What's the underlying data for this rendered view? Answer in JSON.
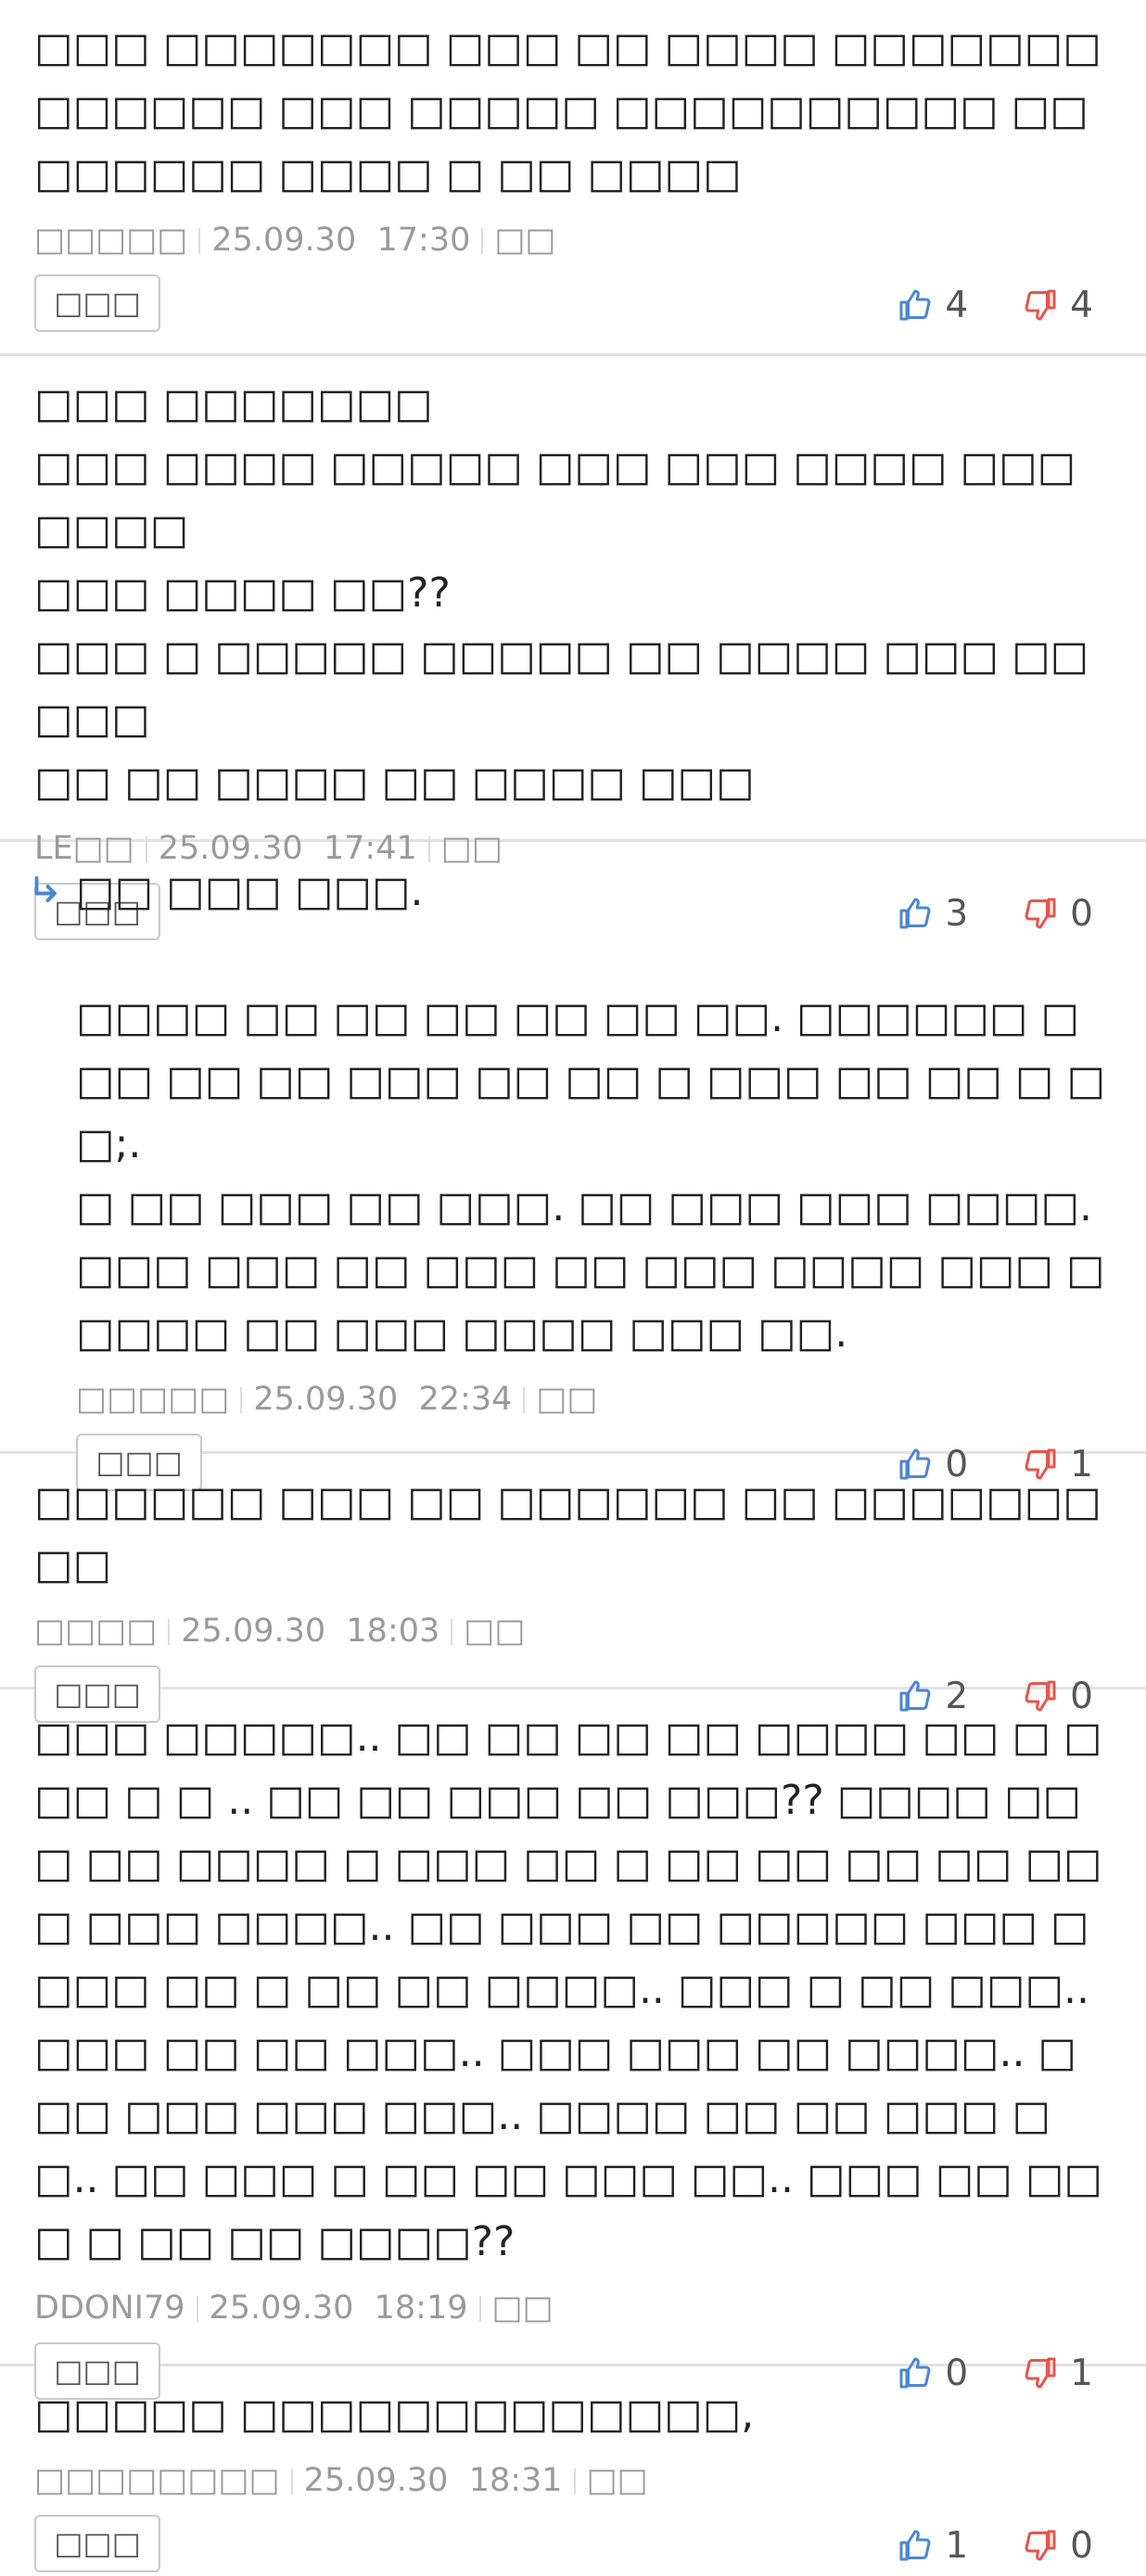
{
  "reply_label": "□□□",
  "comments": [
    {
      "text": "□□□ □□□□□□□ □□□ □□ □□□□ □□□□□□□ □□□□□□ □□□ □□□□□ □□□□□□□□□□ □□ □□□□□□ □□□□ □ □□ □□□□",
      "author": "□□□□□",
      "date": "25.09.30",
      "time": "17:30",
      "action": "□□",
      "up": "4",
      "down": "4"
    },
    {
      "text": "□□□ □□□□□□□\n□□□ □□□□ □□□□□ □□□ □□□ □□□□ □□□□□□□\n□□□ □□□□ □□??\n□□□ □ □□□□□ □□□□□ □□ □□□□ □□□ □□□□□\n□□ □□ □□□□ □□ □□□□ □□□",
      "author": "LE□□",
      "date": "25.09.30",
      "time": "17:41",
      "action": "□□",
      "up": "3",
      "down": "0"
    },
    {
      "text": "□□ □□□ □□□.\n\n□□□□ □□ □□ □□ □□ □□ □□. □□□□□□ □□□ □□ □□ □□□ □□ □□ □ □□□ □□ □□ □ □□;.\n□ □□ □□□ □□ □□□. □□ □□□ □□□ □□□□. □□□ □□□ □□ □□□ □□ □□□ □□□□ □□□ □□□□□ □□ □□□ □□□□ □□□ □□.",
      "author": "□□□□□",
      "date": "25.09.30",
      "time": "22:34",
      "action": "□□",
      "up": "0",
      "down": "1"
    },
    {
      "text": "□□□□□□ □□□ □□ □□□□□□ □□ □□□□□□□□□",
      "author": "□□□□",
      "date": "25.09.30",
      "time": "18:03",
      "action": "□□",
      "up": "2",
      "down": "0"
    },
    {
      "text": "□□□ □□□□□.. □□ □□ □□ □□ □□□□ □□ □ □□□ □ □ .. □□ □□ □□□ □□ □□□?? □□□□ □□□ □□ □□□□ □ □□□ □□ □ □□ □□ □□ □□ □□□ □□□ □□□□.. □□ □□□ □□ □□□□□ □□□ □□□□ □□ □ □□ □□ □□□□.. □□□ □ □□ □□□.. □□□ □□ □□ □□□.. □□□ □□□ □□ □□□□.. □□□ □□□ □□□ □□□.. □□□□ □□ □□ □□□ □□.. □□ □□□ □ □□ □□ □□□ □□.. □□□ □□ □□□ □ □□ □□ □□□□??",
      "author": "DDONI79",
      "date": "25.09.30",
      "time": "18:19",
      "action": "□□",
      "up": "0",
      "down": "1"
    },
    {
      "text": "□□□□□ □□□□□□□□□□□□□,",
      "author": "□□□□□□□□",
      "date": "25.09.30",
      "time": "18:31",
      "action": "□□",
      "up": "1",
      "down": "0"
    }
  ],
  "colors": {
    "like": "#4a86d4",
    "dislike": "#e8544c",
    "meta": "#9a9a9a",
    "divider": "#e2e2e2"
  },
  "icons": {
    "reply_arrow": "reply-arrow-icon",
    "like": "thumbs-up-icon",
    "dislike": "thumbs-down-icon"
  }
}
